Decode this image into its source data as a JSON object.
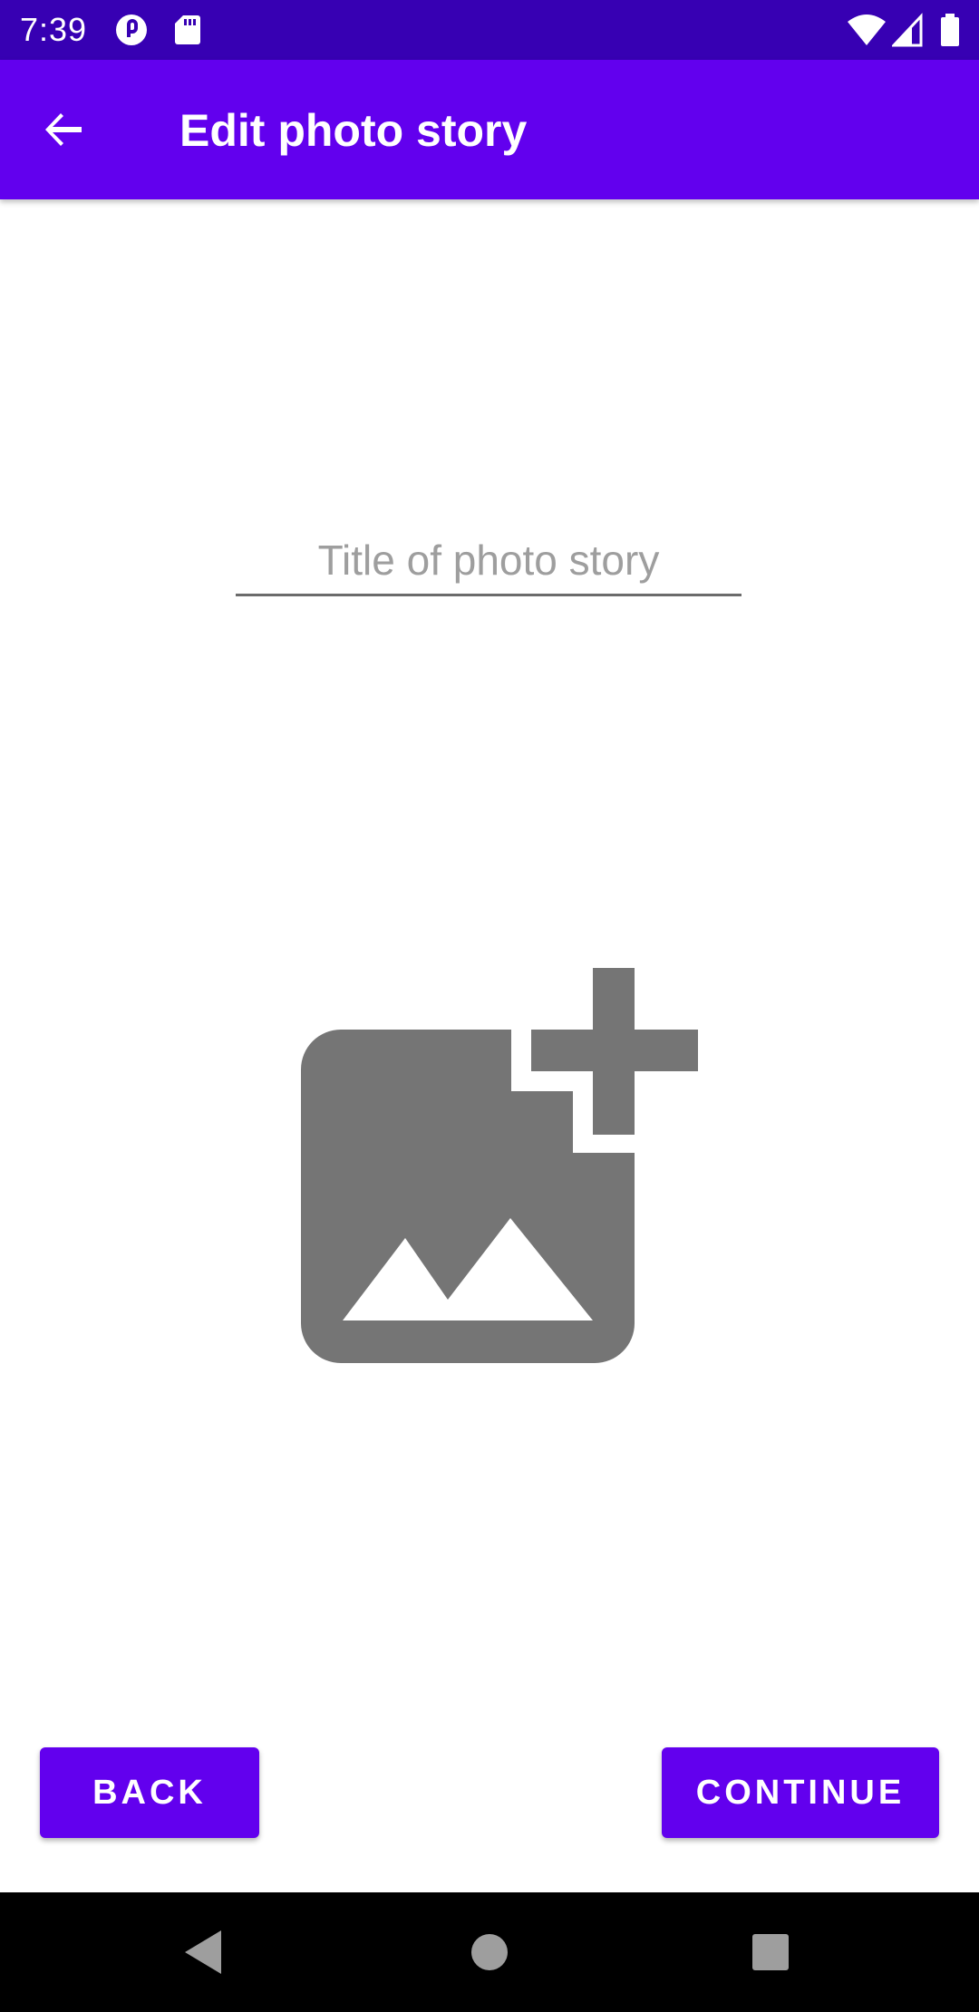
{
  "status_bar": {
    "time": "7:39",
    "left_icons": [
      "pocket-casts-icon",
      "sd-card-icon"
    ],
    "right_icons": [
      "wifi-icon",
      "cell-signal-icon",
      "battery-icon"
    ],
    "background_color": "#3700b3"
  },
  "app_bar": {
    "title": "Edit photo story",
    "back_icon": "arrow-back-icon",
    "background_color": "#6200ee"
  },
  "form": {
    "title_field": {
      "value": "",
      "placeholder": "Title of photo story"
    },
    "add_photo_icon": "add-photo-icon",
    "icon_color": "#757575"
  },
  "buttons": {
    "back_label": "BACK",
    "continue_label": "CONTINUE",
    "color": "#6200ee"
  },
  "nav_bar": {
    "buttons": [
      "nav-back-icon",
      "nav-home-icon",
      "nav-recents-icon"
    ]
  }
}
